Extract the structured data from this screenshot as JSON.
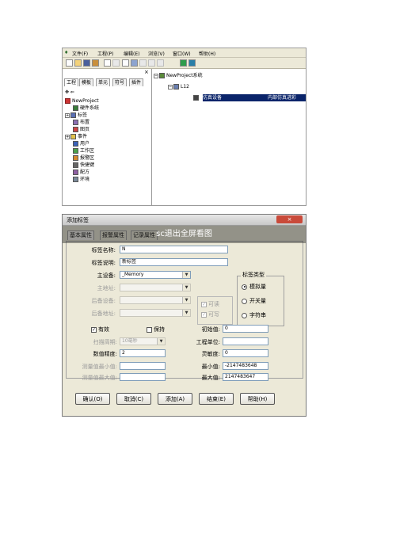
{
  "app": {
    "menu": [
      "文件(F)",
      "工程(P)",
      "编辑(E)",
      "浏览(V)",
      "窗口(W)",
      "帮助(H)"
    ],
    "left_tabs": [
      "工程",
      "模板",
      "单元",
      "符号",
      "插件"
    ],
    "pane_close": "×",
    "pane_arrows": "✥ ⇐",
    "tree": [
      "NewProject",
      "硬件系统",
      "标签",
      "布置",
      "图页",
      "事件",
      "用户",
      "工作区",
      "报警区",
      "快捷键",
      "配方",
      "环境"
    ],
    "right_tree": {
      "root": "NewProject系统",
      "child": "L12",
      "device": "仿真设备",
      "device_desc": "内部仿真进彩"
    }
  },
  "dialog": {
    "title": "添加标签",
    "close": "×",
    "tabs": [
      "基本属性",
      "报警属性",
      "记录属性"
    ],
    "overlay": "sc退出全屏看图",
    "fields": {
      "tag_name_label": "标签名称:",
      "tag_name_value": "N",
      "tag_desc_label": "标签说明:",
      "tag_desc_value": "新标签",
      "main_device_label": "主设备:",
      "main_device_value": "_Memory",
      "main_addr_label": "主地址:",
      "backup_device_label": "后备设备:",
      "backup_addr_label": "后备地址:",
      "readable": "可读",
      "writable": "可写",
      "valid": "有效",
      "keep": "保持",
      "scan_label": "扫描周期:",
      "scan_value": "10毫秒",
      "precision_label": "数值精度:",
      "precision_value": "2",
      "meas_min_label": "测量值最小值:",
      "meas_max_label": "测量值最大值:",
      "init_label": "初始值:",
      "init_value": "0",
      "unit_label": "工程单位:",
      "unit_value": "",
      "sens_label": "灵敏度:",
      "sens_value": "0",
      "min_label": "最小值:",
      "min_value": "-2147483648",
      "max_label": "最大值:",
      "max_value": "2147483647"
    },
    "type_group": {
      "title": "标签类型",
      "options": [
        "模拟量",
        "开关量",
        "字符串"
      ],
      "selected": "模拟量"
    },
    "buttons": [
      "确认(O)",
      "取消(C)",
      "添加(A)",
      "结束(E)",
      "帮助(H)"
    ]
  }
}
